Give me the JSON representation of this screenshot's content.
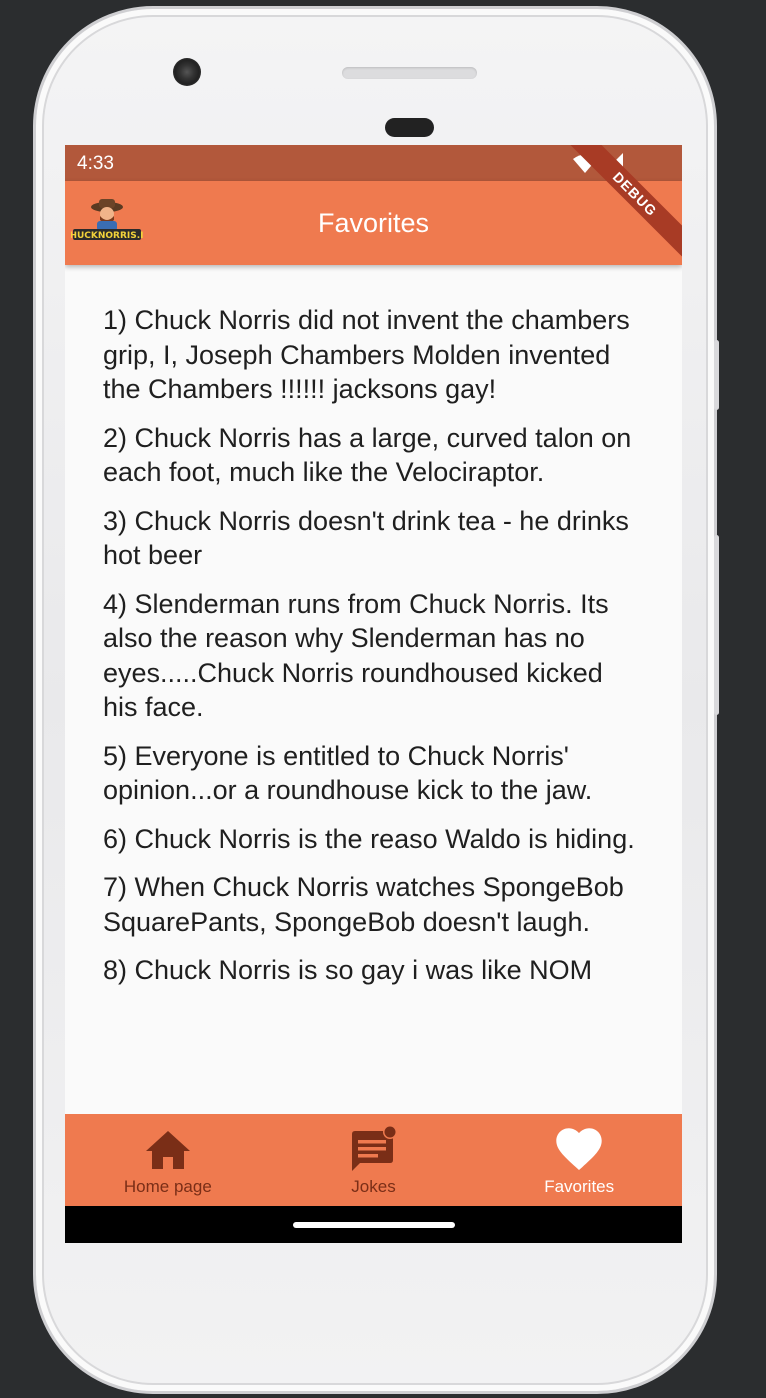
{
  "status_bar": {
    "time": "4:33"
  },
  "app_bar": {
    "title": "Favorites",
    "debug_banner": "DEBUG",
    "logo_alt": "CHUCKNORRIS.IO"
  },
  "jokes": [
    "1) Chuck Norris did not invent the chambers grip, I, Joseph Chambers Molden invented the Chambers !!!!!! jacksons gay!",
    "2) Chuck Norris has a large, curved talon on each foot, much like the Velociraptor.",
    "3) Chuck Norris doesn't drink tea - he drinks hot beer",
    "4) Slenderman runs from Chuck Norris. Its also the reason why Slenderman has no eyes.....Chuck Norris roundhoused kicked his face.",
    "5) Everyone is entitled to Chuck Norris' opinion...or a roundhouse kick to the jaw.",
    "6) Chuck Norris is the reaso Waldo is hiding.",
    "7) When Chuck Norris watches SpongeBob SquarePants, SpongeBob doesn't laugh.",
    "8) Chuck Norris is so gay i was like NOM"
  ],
  "bottom_nav": {
    "items": [
      {
        "label": "Home page",
        "icon": "home-icon"
      },
      {
        "label": "Jokes",
        "icon": "chat-notification-icon"
      },
      {
        "label": "Favorites",
        "icon": "heart-icon"
      }
    ],
    "active_index": 2
  },
  "colors": {
    "accent": "#ef7a4f",
    "status_bar": "#b2583b",
    "inactive_nav": "#7a2e17",
    "active_nav": "#ffffff"
  }
}
